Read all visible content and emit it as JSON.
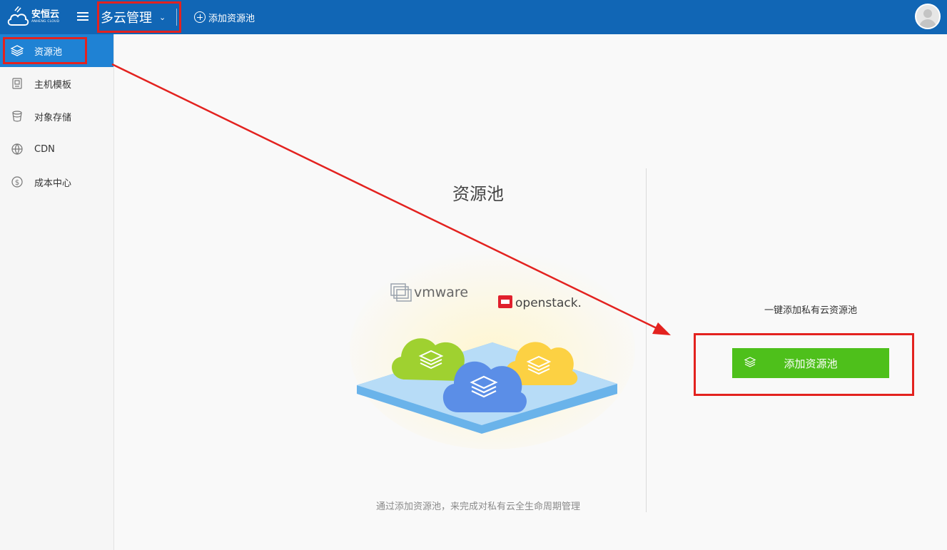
{
  "header": {
    "brand_name": "安恒云",
    "brand_sub": "ANHENG CLOUD",
    "module": "多云管理",
    "add_pool_label": "添加资源池"
  },
  "sidebar": {
    "items": [
      {
        "label": "资源池",
        "icon": "layers-icon",
        "active": true
      },
      {
        "label": "主机模板",
        "icon": "template-icon",
        "active": false
      },
      {
        "label": "对象存储",
        "icon": "bucket-icon",
        "active": false
      },
      {
        "label": "CDN",
        "icon": "globe-icon",
        "active": false
      },
      {
        "label": "成本中心",
        "icon": "dollar-icon",
        "active": false
      }
    ]
  },
  "main": {
    "title": "资源池",
    "caption": "通过添加资源池，来完成对私有云全生命周期管理",
    "logos": [
      "vmware",
      "openstack."
    ],
    "tagline": "一键添加私有云资源池",
    "cta_label": "添加资源池"
  },
  "colors": {
    "header_bg": "#1166b5",
    "active_nav": "#1f82d4",
    "cta_green": "#4ec01b",
    "annotation_red": "#e3221f"
  }
}
